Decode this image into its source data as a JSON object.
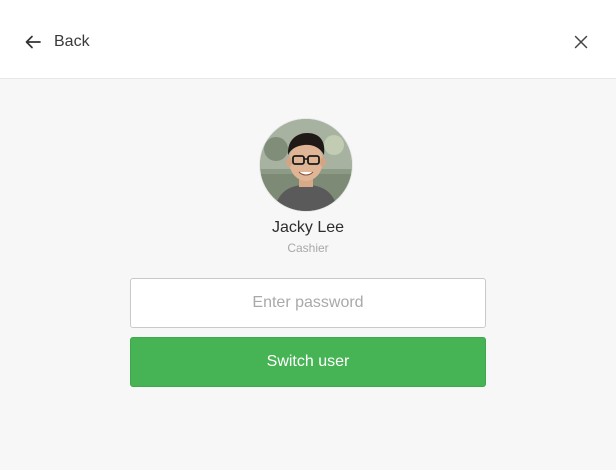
{
  "header": {
    "back_label": "Back",
    "back_icon": "arrow-left-icon",
    "close_icon": "close-icon"
  },
  "user": {
    "name": "Jacky Lee",
    "role": "Cashier",
    "avatar": "user-avatar-photo"
  },
  "form": {
    "password_placeholder": "Enter password",
    "password_value": "",
    "submit_label": "Switch user"
  },
  "colors": {
    "primary_button": "#46b454",
    "background": "#f7f7f7",
    "header": "#ffffff"
  }
}
